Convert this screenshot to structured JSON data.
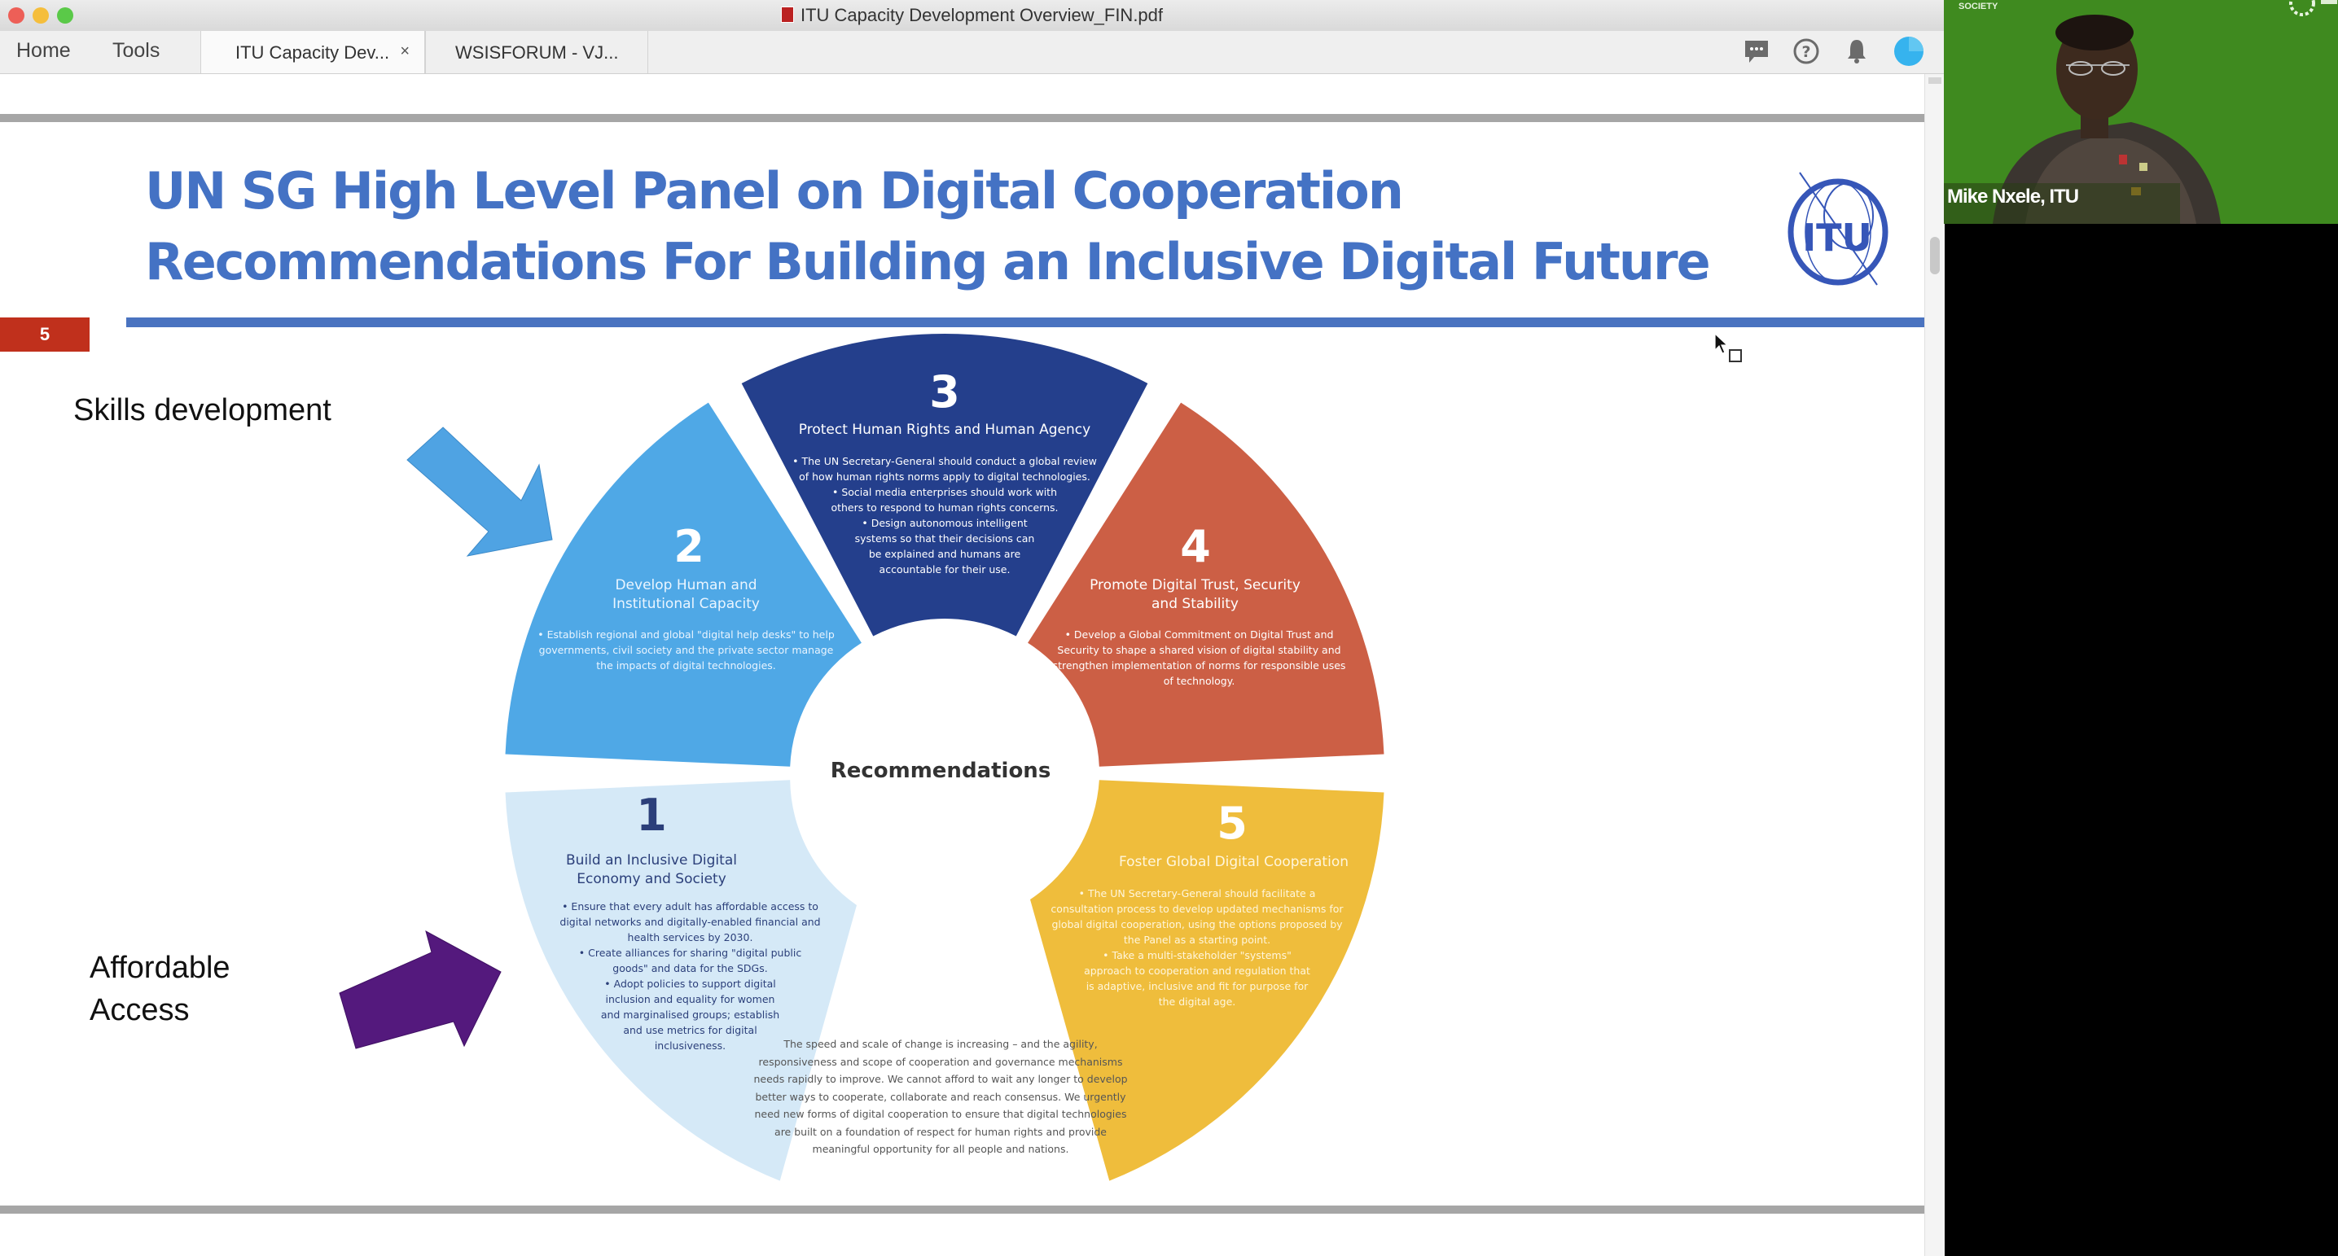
{
  "window": {
    "title": "ITU Capacity Development Overview_FIN.pdf",
    "traffic_lights": {
      "close": "#ed5f57",
      "minimize": "#f5be3c",
      "zoom": "#5ac948"
    }
  },
  "toolbar": {
    "nav": [
      {
        "label": "Home"
      },
      {
        "label": "Tools"
      }
    ],
    "tabs": [
      {
        "label": "ITU Capacity Dev...",
        "active": true,
        "close_glyph": "×"
      },
      {
        "label": "WSISFORUM - VJ...",
        "active": false
      }
    ],
    "icons": [
      "comment-icon",
      "help-icon",
      "bell-icon",
      "profile-icon"
    ],
    "help_glyph": "?"
  },
  "slide": {
    "page_number": "5",
    "title_line1": "UN SG High Level Panel on Digital Cooperation",
    "title_line2": "Recommendations For Building an Inclusive Digital Future",
    "logo_text": "ITU",
    "annotations": {
      "skills": "Skills development",
      "affordable_line1": "Affordable",
      "affordable_line2": "Access"
    },
    "arrow_colors": {
      "skills": "#4fa3e3",
      "affordable": "#54197d"
    },
    "center_label": "Recommendations",
    "segments": [
      {
        "number": "1",
        "title": "Build an Inclusive Digital Economy and Society",
        "bullets": [
          "Ensure that every adult has affordable access to digital networks and digitally-enabled financial and health services by 2030.",
          "Create alliances for sharing \"digital public goods\" and data for the SDGs.",
          "Adopt policies to support digital inclusion and equality for women and marginalised groups; establish and use metrics for digital inclusiveness."
        ],
        "color": "#d5e9f7",
        "text_color": "#2b3f7a"
      },
      {
        "number": "2",
        "title": "Develop Human and Institutional Capacity",
        "bullets": [
          "Establish regional and global \"digital help desks\" to help governments, civil society and the private sector manage the impacts of digital technologies."
        ],
        "color": "#4fa8e6",
        "text_color": "#ffffff"
      },
      {
        "number": "3",
        "title": "Protect Human Rights and Human Agency",
        "bullets": [
          "The UN Secretary-General should conduct a global review of how human rights norms apply to digital technologies.",
          "Social media enterprises should work with others to respond to human rights concerns.",
          "Design autonomous intelligent systems so that their decisions can be explained and humans are accountable for their use."
        ],
        "color": "#243f8c",
        "text_color": "#ffffff"
      },
      {
        "number": "4",
        "title": "Promote Digital Trust, Security and Stability",
        "bullets": [
          "Develop a Global Commitment on Digital Trust and Security to shape a shared vision of digital stability and strengthen implementation of norms for responsible uses of technology."
        ],
        "color": "#cc5f45",
        "text_color": "#ffffff"
      },
      {
        "number": "5",
        "title": "Foster Global Digital Cooperation",
        "bullets": [
          "The UN Secretary-General should facilitate a consultation process to develop updated mechanisms for global digital cooperation, using the options proposed by the Panel as a starting point.",
          "Take a multi-stakeholder \"systems\" approach to cooperation and regulation that is adaptive, inclusive and fit for purpose for the digital age."
        ],
        "color": "#efbd3c",
        "text_color": "#fff6dc"
      }
    ],
    "quote": "The speed and scale of change is increasing – and the agility, responsiveness and scope of cooperation and governance mechanisms needs rapidly to improve. We cannot afford to wait any longer to develop better ways to cooperate, collaborate and reach consensus. We urgently need new forms of digital cooperation to ensure that digital technologies are built on a foundation of respect for human rights and provide meaningful opportunity for all people and nations."
  },
  "video": {
    "participant_name": "Mike Nxele, ITU",
    "background_text": "SOCIETY"
  },
  "colors": {
    "title_blue": "#4472c4",
    "rule_blue": "#4a73c0",
    "badge_red": "#c0301c"
  }
}
